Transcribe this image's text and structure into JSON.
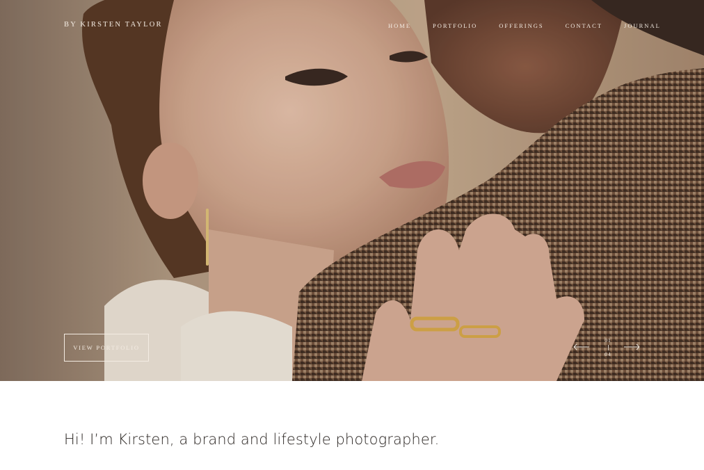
{
  "brand": "BY KIRSTEN TAYLOR",
  "nav": [
    "HOME",
    "PORTFOLIO",
    "OFFERINGS",
    "CONTACT",
    "JOURNAL"
  ],
  "hero": {
    "cta_label": "VIEW PORTFOLIO",
    "slide_current": "01",
    "slide_total": "04"
  },
  "intro": {
    "headline": "Hi! I’m Kirsten, a brand and lifestyle photographer."
  },
  "colors": {
    "overlay_text": "#f4ece3",
    "body_text": "#2b2623",
    "background": "#ffffff"
  },
  "icons": {
    "prev": "arrow-left-icon",
    "next": "arrow-right-icon"
  }
}
